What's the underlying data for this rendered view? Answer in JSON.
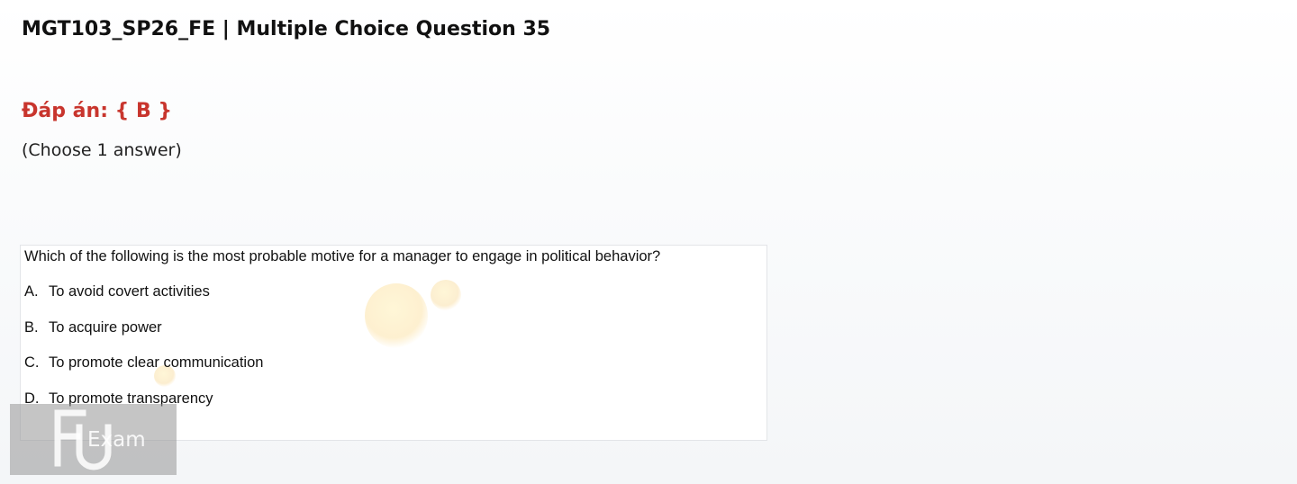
{
  "page": {
    "title": "MGT103_SP26_FE | Multiple Choice Question 35",
    "answer_key": "Đáp án: { B }",
    "instruction": "(Choose 1 answer)"
  },
  "question": {
    "text": "Which of the following is the most probable motive for a manager to engage in political behavior?",
    "options": [
      {
        "letter": "A.",
        "text": "To avoid covert activities"
      },
      {
        "letter": "B.",
        "text": "To acquire power"
      },
      {
        "letter": "C.",
        "text": "To promote clear communication"
      },
      {
        "letter": "D.",
        "text": "To promote transparency"
      }
    ]
  },
  "watermark": {
    "logo_letters": "FU",
    "text": "Exam"
  },
  "colors": {
    "answer_key": "#c8352d",
    "title": "#111111",
    "watermark_background": "#969696"
  }
}
